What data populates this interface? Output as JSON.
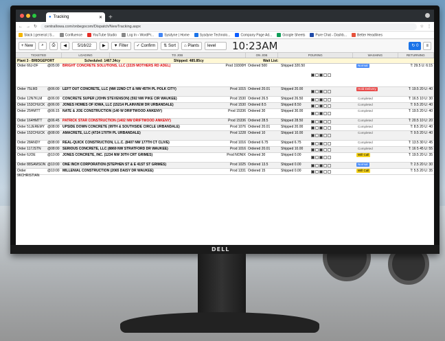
{
  "browser": {
    "tab_title": "Tracking",
    "url": "centralIowa.com/onbegocom/Dispatch/NewTracking.aspx",
    "bookmarks": [
      "Slack | general | S...",
      "Confluence",
      "YouTube Studio",
      "Log In ‹ WordPr...",
      "Sysdyne | Home",
      "Sysdyne Technolo...",
      "Company Page Ad...",
      "Google Sheets",
      "Pure Chat - Dashb...",
      "Better Headlines"
    ]
  },
  "toolbar": {
    "new": "New",
    "date": "5/16/22",
    "filter": "Filter",
    "confirm": "Confirm",
    "sort": "Sort",
    "plants": "Plants",
    "truck": "level",
    "clock": "10:23AM",
    "count": "0"
  },
  "columns": [
    "TICKETED",
    "LOADING",
    "TO JOB",
    "ON JOB",
    "POURING",
    "WASHING",
    "RETURNING"
  ],
  "plant": {
    "name": "Plant 3 - BRIDGEPORT",
    "scheduled": "Scheduled: 1467.34cy",
    "shipped": "Shipped: 485.85cy",
    "wait": "Wait List:"
  },
  "rows": [
    {
      "order": "Order 66J-DF",
      "time": "@05:00",
      "name": "BRIGHT CONCRETE SOLUTIONS, LLC (2229 MOTHERS RD ADEL)",
      "red": true,
      "prod": "Prod 19300H",
      "ordered": "Ordered 500",
      "shipped": "Shipped 320.50",
      "status": "Normal",
      "status_type": "norm",
      "ret": "T: 29.5  U: 6:15"
    },
    {
      "order": "Order 75LM3",
      "time": "@06:00",
      "name": "LEFT OUT CONCRETE, LLC (NW 22ND CT & NW 45TH PL  POLK CITY)",
      "red": false,
      "prod": "Prod 1015",
      "ordered": "Ordered 20.01",
      "shipped": "Shipped 20.00",
      "status": "Hold Delivery",
      "status_type": "hold",
      "ret": "T: 19.5  20 U: 40"
    },
    {
      "order": "Order 12N7KLM",
      "time": "@06:00",
      "name": "CONCRETE SUPER (JOHN STEVENSON) (592 NW PIKE CIR WAUKEE)",
      "red": false,
      "prod": "Prod 1530",
      "ordered": "Ordered 26.5",
      "shipped": "Shipped 26.50",
      "status": "Completed",
      "status_type": "comp",
      "ret": "T: 16.5  10 U: 30"
    },
    {
      "order": "Order 153CHUCK",
      "time": "@06:00",
      "name": "JONES HOMES OF IOWA, LLC (15214 PLAINVIEW DR URBANDALE)",
      "red": false,
      "prod": "Prod 1530",
      "ordered": "Ordered 8.5",
      "shipped": "Shipped 8.50",
      "status": "Completed",
      "status_type": "comp",
      "ret": "T: 9.5  20 U: 40"
    },
    {
      "order": "Order 25HMTT",
      "time": "@06:15",
      "name": "NATE & JOE CONSTRUCTION (140 W DRIFTWOOD ANKENY)",
      "red": false,
      "prod": "Prod 15336",
      "ordered": "Ordered 30",
      "shipped": "Shipped 30.00",
      "status": "Completed",
      "status_type": "comp",
      "ret": "T: 19.5  20 U: 40"
    },
    {
      "order": "Order 164HMTT",
      "time": "@06:45",
      "name": "PATRICK STAR CONSTRUCTION (1402 NW DRIFTWOOD ANKENY)",
      "red": true,
      "prod": "Prod 15336",
      "ordered": "Ordered 28.5",
      "shipped": "Shipped 28.50",
      "status": "Completed",
      "status_type": "comp",
      "ret": "T: 20.5  10 U: 20"
    },
    {
      "order": "Order 51JEREMY",
      "time": "@08:00",
      "name": "UPSIDE DOWN CONCRETE (99TH & SOUTHSIDE CIRCLE URBANDALE)",
      "red": false,
      "prod": "Prod 1076",
      "ordered": "Ordered 20.01",
      "shipped": "Shipped 20.00",
      "status": "Completed",
      "status_type": "comp",
      "ret": "T: 8.5  20 U: 40"
    },
    {
      "order": "Order 152CHUCK",
      "time": "@08:00",
      "name": "AMACRETE, LLC (4724 170TH PL URBANDALE)",
      "red": false,
      "prod": "Prod 1228",
      "ordered": "Ordered 10",
      "shipped": "Shipped 10.00",
      "status": "Completed",
      "status_type": "comp",
      "ret": "T: 9.5  20 U: 40"
    },
    {
      "order": "Order 28ANDY",
      "time": "@08:00",
      "name": "REAL-QUICK CONSTRUCTION, L.L.C. (8407 NW 177TH CT CLIVE)",
      "red": false,
      "prod": "Prod 1016",
      "ordered": "Ordered 6.75",
      "shipped": "Shipped 6.75",
      "status": "Completed",
      "status_type": "comp",
      "ret": "T: 13.5  30 U: 45"
    },
    {
      "order": "Order 117JSTN",
      "time": "@08:00",
      "name": "SERIOUS CONCRETE, LLC (8869 NW STRATFORD DR  WAUKEE)",
      "red": false,
      "prod": "Prod 1016",
      "ordered": "Ordered 20.01",
      "shipped": "Shipped 10.00",
      "status": "Completed",
      "status_type": "comp",
      "ret": "T: 16 5  45 U: 55"
    },
    {
      "order": "Order 6JOE",
      "time": "@10:00",
      "name": "JONES CONCRETE, INC. (1234 NW 30TH CRT GRIMES)",
      "red": false,
      "prod": "Prod NONIX",
      "ordered": "Ordered 30",
      "shipped": "Shipped 0.00",
      "status": "Will Call",
      "status_type": "will",
      "ret": "T: 19.5  20 U: 35"
    },
    {
      "order": "Order 88SAMSON",
      "time": "@10:00",
      "name": "ONE INCH CORPORATION (STEPHEN ST & E 41ST ST GRIMES)",
      "red": false,
      "prod": "Prod 1025",
      "ordered": "Ordered 13.5",
      "shipped": "Shipped 0.00",
      "status": "Normal",
      "status_type": "norm",
      "ret": "T: 2.5  20 U: 30"
    },
    {
      "order": "Order 96CHRISTIAN",
      "time": "@10:00",
      "name": "MILLENIAL CONSTRUCTION (2065 DAISY DR  WAUKEE)",
      "red": false,
      "prod": "Prod 1331",
      "ordered": "Ordered 15",
      "shipped": "Shipped 0.00",
      "status": "Will Call",
      "status_type": "will",
      "ret": "T: 5.5  20 U: 35"
    }
  ],
  "brand": "DELL"
}
